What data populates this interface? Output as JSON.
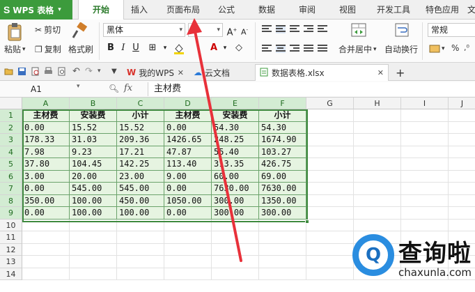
{
  "app": {
    "name": "WPS 表格",
    "logo": "S"
  },
  "menu_tabs": [
    "开始",
    "插入",
    "页面布局",
    "公式",
    "数据",
    "审阅",
    "视图",
    "开发工具",
    "特色应用",
    "文"
  ],
  "ribbon": {
    "paste": "粘贴",
    "cut": "剪切",
    "copy": "复制",
    "format_painter": "格式刷",
    "font_name": "黑体",
    "font_size": "",
    "merge_center": "合并居中",
    "wrap_text": "自动换行",
    "number_format": "常规",
    "percent": "%"
  },
  "doc_tabs": [
    {
      "label": "我的WPS",
      "icon": "wps-logo-icon"
    },
    {
      "label": "云文档",
      "icon": "cloud-icon"
    },
    {
      "label": "数据表格.xlsx",
      "icon": "sheet-icon"
    }
  ],
  "formula_bar": {
    "cell_ref": "A1",
    "fx": "fx",
    "value": "主材费"
  },
  "sheet": {
    "columns": [
      "A",
      "B",
      "C",
      "D",
      "E",
      "F",
      "G",
      "H",
      "I",
      "J"
    ],
    "rows": [
      "1",
      "2",
      "3",
      "4",
      "5",
      "6",
      "7",
      "8",
      "9",
      "10",
      "11",
      "12",
      "13",
      "14"
    ],
    "header_row": [
      "主材费",
      "安装费",
      "小计",
      "主材费",
      "安装费",
      "小计"
    ],
    "data_rows": [
      [
        "0.00",
        "15.52",
        "15.52",
        "0.00",
        "54.30",
        "54.30"
      ],
      [
        "178.33",
        "31.03",
        "209.36",
        "1426.65",
        "248.25",
        "1674.90"
      ],
      [
        "7.98",
        "9.23",
        "17.21",
        "47.87",
        "55.40",
        "103.27"
      ],
      [
        "37.80",
        "104.45",
        "142.25",
        "113.40",
        "313.35",
        "426.75"
      ],
      [
        "3.00",
        "20.00",
        "23.00",
        "9.00",
        "60.00",
        "69.00"
      ],
      [
        "0.00",
        "545.00",
        "545.00",
        "0.00",
        "7630.00",
        "7630.00"
      ],
      [
        "350.00",
        "100.00",
        "450.00",
        "1050.00",
        "300.00",
        "1350.00"
      ],
      [
        "0.00",
        "100.00",
        "100.00",
        "0.00",
        "300.00",
        "300.00"
      ]
    ]
  },
  "watermark": {
    "title": "查询啦",
    "url": "chaxunla.com"
  },
  "colors": {
    "accent": "#3c9b3c",
    "selection": "#3f8a3f",
    "cell_fill": "#e6f4e1",
    "arrow": "#e8313a"
  }
}
